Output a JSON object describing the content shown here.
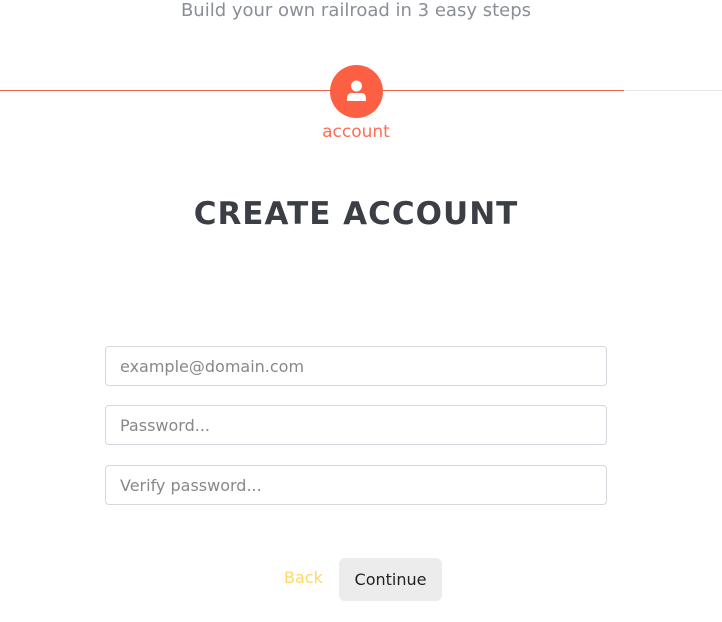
{
  "header": {
    "subtitle": "Build your own railroad in 3 easy steps"
  },
  "stepper": {
    "current_step": {
      "label": "account",
      "icon": "user-icon"
    },
    "accent_color": "#fd5f42"
  },
  "form": {
    "title": "CREATE ACCOUNT",
    "email": {
      "value": "",
      "placeholder": "example@domain.com"
    },
    "password": {
      "value": "",
      "placeholder": "Password..."
    },
    "verify_password": {
      "value": "",
      "placeholder": "Verify password..."
    }
  },
  "actions": {
    "back_label": "Back",
    "continue_label": "Continue"
  }
}
